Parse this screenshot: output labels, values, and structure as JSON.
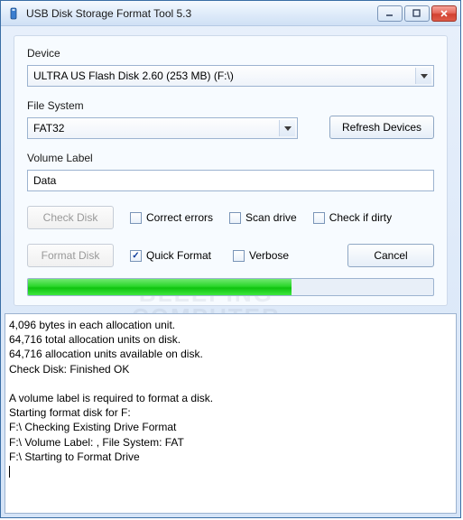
{
  "window": {
    "title": "USB Disk Storage Format Tool 5.3"
  },
  "labels": {
    "device": "Device",
    "filesystem": "File System",
    "volume": "Volume Label"
  },
  "device": {
    "selected": "ULTRA US  Flash Disk  2.60 (253 MB) (F:\\)"
  },
  "filesystem": {
    "selected": "FAT32"
  },
  "volume": {
    "value": "Data"
  },
  "buttons": {
    "refresh": "Refresh Devices",
    "checkdisk": "Check Disk",
    "formatdisk": "Format Disk",
    "cancel": "Cancel"
  },
  "checkboxes": {
    "correct_errors": {
      "label": "Correct errors",
      "checked": false
    },
    "scan_drive": {
      "label": "Scan drive",
      "checked": false
    },
    "check_dirty": {
      "label": "Check if dirty",
      "checked": false
    },
    "quick_format": {
      "label": "Quick Format",
      "checked": true
    },
    "verbose": {
      "label": "Verbose",
      "checked": false
    }
  },
  "progress": {
    "percent": 65
  },
  "log_text": "4,096 bytes in each allocation unit.\n64,716 total allocation units on disk.\n64,716 allocation units available on disk.\nCheck Disk: Finished OK\n\nA volume label is required to format a disk.\nStarting format disk for F:\nF:\\ Checking Existing Drive Format\nF:\\ Volume Label: , File System: FAT\nF:\\ Starting to Format Drive",
  "watermark": "BLEEPING\nCOMPUTER"
}
